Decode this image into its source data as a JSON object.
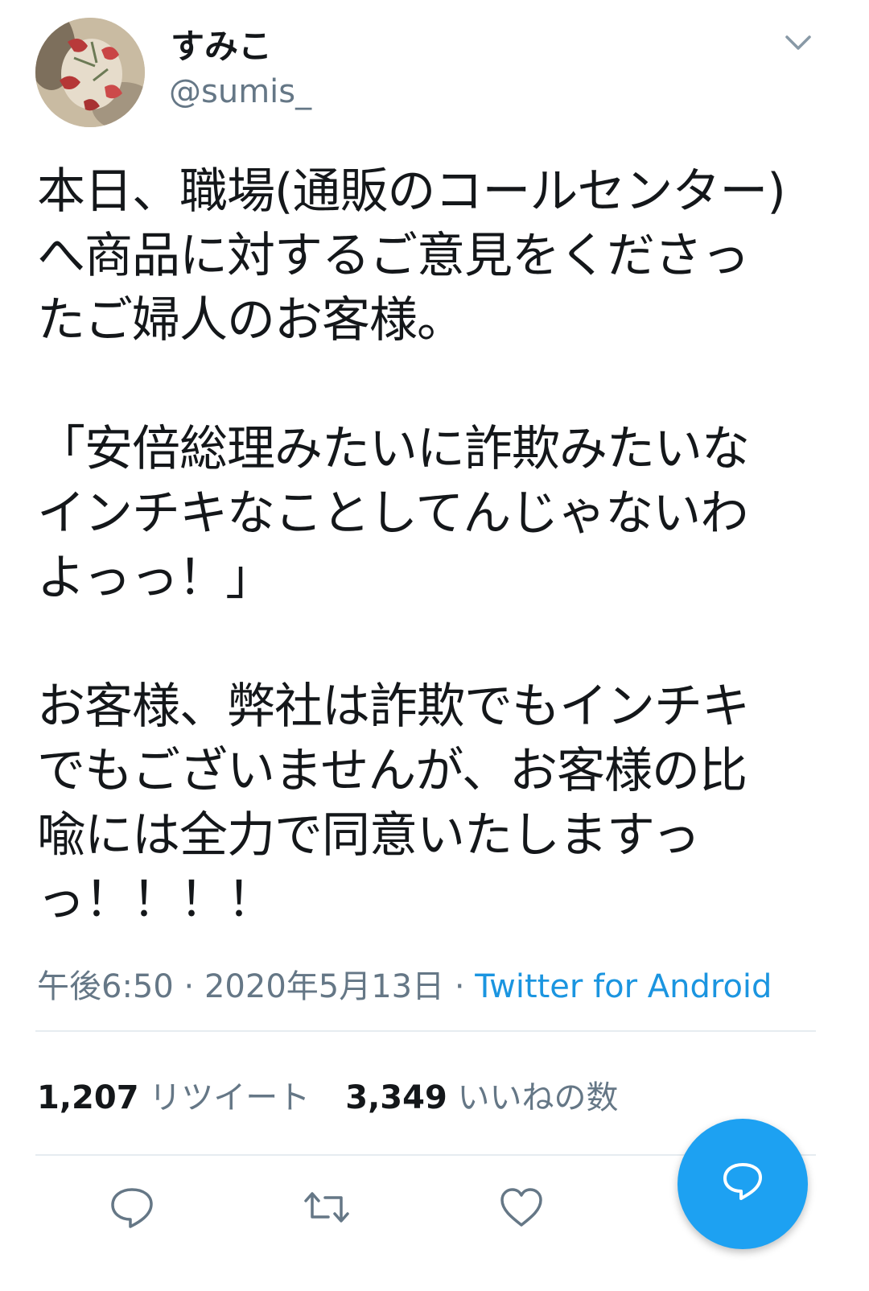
{
  "user": {
    "display_name": "すみこ",
    "handle": "@sumis_"
  },
  "tweet": {
    "paragraphs": [
      "本日、職場(通販のコールセンター)\nへ商品に対するご意見をくださっ\nたご婦人のお客様。",
      "「安倍総理みたいに詐欺みたいな\nインチキなことしてんじゃないわ\nよっっ！」",
      "お客様、弊社は詐欺でもインチキ\nでもございませんが、お客様の比\n喩には全力で同意いたしますっ\nっ！！！！"
    ],
    "time": "午後6:50",
    "separator": " · ",
    "date": "2020年5月13日",
    "source": "Twitter for Android"
  },
  "stats": {
    "retweets_count": "1,207",
    "retweets_label": "リツイート",
    "likes_count": "3,349",
    "likes_label": "いいねの数"
  },
  "icons": {
    "caret": "chevron-down-icon",
    "reply": "reply-icon",
    "retweet": "retweet-icon",
    "like": "heart-icon",
    "compose": "compose-reply-icon"
  },
  "colors": {
    "text": "#14171a",
    "secondary": "#657786",
    "accent": "#1da1f2",
    "link": "#1b95e0",
    "divider": "#e6ecf0"
  }
}
